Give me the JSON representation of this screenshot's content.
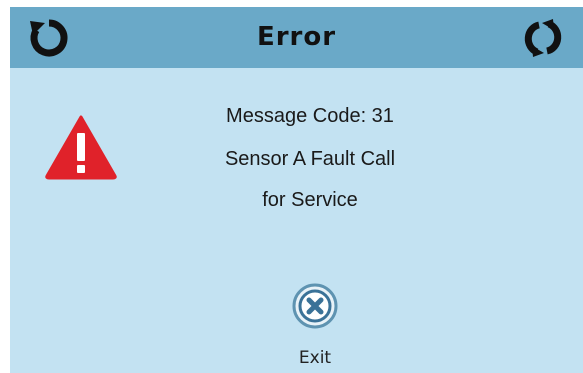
{
  "header": {
    "title": "Error",
    "left_icon": "restart-icon",
    "right_icon": "refresh-icon"
  },
  "alert": {
    "icon": "warning-triangle-icon",
    "line1": "Message Code: 31",
    "line2": "Sensor A Fault Call",
    "line3": "for Service"
  },
  "footer": {
    "exit_icon": "close-circle-icon",
    "exit_label": "Exit"
  },
  "colors": {
    "background": "#c3e2f2",
    "titlebar": "#6aa9c8",
    "warning": "#e0222a",
    "exit_ring": "#5e93b1",
    "exit_x": "#3a7298"
  }
}
